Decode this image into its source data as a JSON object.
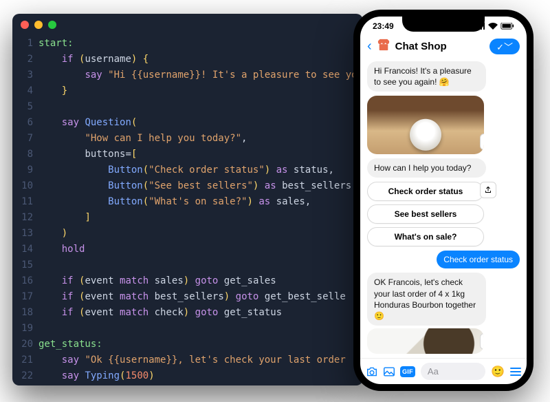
{
  "code": {
    "lines": [
      {
        "n": 1,
        "tokens": [
          [
            "t-label",
            "start:"
          ]
        ]
      },
      {
        "n": 2,
        "tokens": [
          [
            "",
            "    "
          ],
          [
            "t-keyword",
            "if"
          ],
          [
            "",
            " "
          ],
          [
            "t-paren",
            "("
          ],
          [
            "t-ident",
            "username"
          ],
          [
            "t-paren",
            ")"
          ],
          [
            "",
            " "
          ],
          [
            "t-paren",
            "{"
          ]
        ]
      },
      {
        "n": 3,
        "tokens": [
          [
            "",
            "        "
          ],
          [
            "t-keyword",
            "say"
          ],
          [
            "",
            " "
          ],
          [
            "t-string",
            "\"Hi {{username}}! It's a pleasure to see yo"
          ]
        ]
      },
      {
        "n": 4,
        "tokens": [
          [
            "",
            "    "
          ],
          [
            "t-paren",
            "}"
          ]
        ]
      },
      {
        "n": 5,
        "tokens": []
      },
      {
        "n": 6,
        "tokens": [
          [
            "",
            "    "
          ],
          [
            "t-keyword",
            "say"
          ],
          [
            "",
            " "
          ],
          [
            "t-func",
            "Question"
          ],
          [
            "t-paren",
            "("
          ]
        ]
      },
      {
        "n": 7,
        "tokens": [
          [
            "",
            "        "
          ],
          [
            "t-string",
            "\"How can I help you today?\""
          ],
          [
            "",
            ","
          ]
        ]
      },
      {
        "n": 8,
        "tokens": [
          [
            "",
            "        "
          ],
          [
            "t-ident",
            "buttons"
          ],
          [
            "",
            "="
          ],
          [
            "t-paren",
            "["
          ]
        ]
      },
      {
        "n": 9,
        "tokens": [
          [
            "",
            "            "
          ],
          [
            "t-func",
            "Button"
          ],
          [
            "t-paren",
            "("
          ],
          [
            "t-string",
            "\"Check order status\""
          ],
          [
            "t-paren",
            ")"
          ],
          [
            "",
            " "
          ],
          [
            "t-keyword",
            "as"
          ],
          [
            "",
            " "
          ],
          [
            "t-ident",
            "status"
          ],
          [
            "",
            ","
          ]
        ]
      },
      {
        "n": 10,
        "tokens": [
          [
            "",
            "            "
          ],
          [
            "t-func",
            "Button"
          ],
          [
            "t-paren",
            "("
          ],
          [
            "t-string",
            "\"See best sellers\""
          ],
          [
            "t-paren",
            ")"
          ],
          [
            "",
            " "
          ],
          [
            "t-keyword",
            "as"
          ],
          [
            "",
            " "
          ],
          [
            "t-ident",
            "best_sellers"
          ],
          [
            "",
            ","
          ]
        ]
      },
      {
        "n": 11,
        "tokens": [
          [
            "",
            "            "
          ],
          [
            "t-func",
            "Button"
          ],
          [
            "t-paren",
            "("
          ],
          [
            "t-string",
            "\"What's on sale?\""
          ],
          [
            "t-paren",
            ")"
          ],
          [
            "",
            " "
          ],
          [
            "t-keyword",
            "as"
          ],
          [
            "",
            " "
          ],
          [
            "t-ident",
            "sales"
          ],
          [
            "",
            ","
          ]
        ]
      },
      {
        "n": 12,
        "tokens": [
          [
            "",
            "        "
          ],
          [
            "t-paren",
            "]"
          ]
        ]
      },
      {
        "n": 13,
        "tokens": [
          [
            "",
            "    "
          ],
          [
            "t-paren",
            ")"
          ]
        ]
      },
      {
        "n": 14,
        "tokens": [
          [
            "",
            "    "
          ],
          [
            "t-keyword",
            "hold"
          ]
        ]
      },
      {
        "n": 15,
        "tokens": []
      },
      {
        "n": 16,
        "tokens": [
          [
            "",
            "    "
          ],
          [
            "t-keyword",
            "if"
          ],
          [
            "",
            " "
          ],
          [
            "t-paren",
            "("
          ],
          [
            "t-ident",
            "event "
          ],
          [
            "t-keyword",
            "match"
          ],
          [
            "t-ident",
            " sales"
          ],
          [
            "t-paren",
            ")"
          ],
          [
            "",
            " "
          ],
          [
            "t-keyword",
            "goto"
          ],
          [
            "",
            " "
          ],
          [
            "t-ident",
            "get_sales"
          ]
        ]
      },
      {
        "n": 17,
        "tokens": [
          [
            "",
            "    "
          ],
          [
            "t-keyword",
            "if"
          ],
          [
            "",
            " "
          ],
          [
            "t-paren",
            "("
          ],
          [
            "t-ident",
            "event "
          ],
          [
            "t-keyword",
            "match"
          ],
          [
            "t-ident",
            " best_sellers"
          ],
          [
            "t-paren",
            ")"
          ],
          [
            "",
            " "
          ],
          [
            "t-keyword",
            "goto"
          ],
          [
            "",
            " "
          ],
          [
            "t-ident",
            "get_best_selle"
          ]
        ]
      },
      {
        "n": 18,
        "tokens": [
          [
            "",
            "    "
          ],
          [
            "t-keyword",
            "if"
          ],
          [
            "",
            " "
          ],
          [
            "t-paren",
            "("
          ],
          [
            "t-ident",
            "event "
          ],
          [
            "t-keyword",
            "match"
          ],
          [
            "t-ident",
            " check"
          ],
          [
            "t-paren",
            ")"
          ],
          [
            "",
            " "
          ],
          [
            "t-keyword",
            "goto"
          ],
          [
            "",
            " "
          ],
          [
            "t-ident",
            "get_status"
          ]
        ]
      },
      {
        "n": 19,
        "tokens": []
      },
      {
        "n": 20,
        "tokens": [
          [
            "t-label",
            "get_status:"
          ]
        ]
      },
      {
        "n": 21,
        "tokens": [
          [
            "",
            "    "
          ],
          [
            "t-keyword",
            "say"
          ],
          [
            "",
            " "
          ],
          [
            "t-string",
            "\"Ok {{username}}, let's check your last order"
          ]
        ]
      },
      {
        "n": 22,
        "tokens": [
          [
            "",
            "    "
          ],
          [
            "t-keyword",
            "say"
          ],
          [
            "",
            " "
          ],
          [
            "t-func",
            "Typing"
          ],
          [
            "t-paren",
            "("
          ],
          [
            "t-num",
            "1500"
          ],
          [
            "t-paren",
            ")"
          ]
        ]
      }
    ]
  },
  "phone": {
    "status_time": "23:49",
    "nav": {
      "title": "Chat Shop",
      "pill": "✓﹀"
    },
    "greeting": "Hi Francois! It's a pleasure to see you again! 🤗",
    "question": "How can I help you today?",
    "quick_replies": [
      "Check order status",
      "See best sellers",
      "What's on sale?"
    ],
    "user_reply": "Check order status",
    "followup": "OK Francois, let's check your last order of 4 x 1kg Honduras Bourbon together 🙂",
    "composer_placeholder": "Aa",
    "gif_label": "GIF"
  }
}
